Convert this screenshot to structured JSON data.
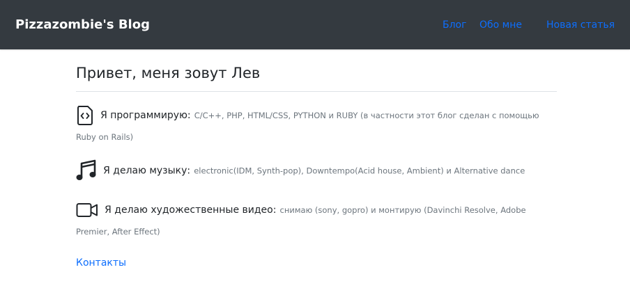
{
  "navbar": {
    "brand": "Pizzazombie's Blog",
    "links": [
      {
        "label": "Блог"
      },
      {
        "label": "Обо мне"
      },
      {
        "label": "Новая статья"
      }
    ],
    "background": "#343a40",
    "link_color": "#0d6efd"
  },
  "main": {
    "title": "Привет, меня зовут Лев",
    "items": [
      {
        "icon": "file-code-icon",
        "lead": "Я программирую:",
        "detail": "C/C++, PHP, HTML/CSS, PYTHON и RUBY (в частности этот блог сделан с помощью Ruby on Rails)"
      },
      {
        "icon": "music-note-icon",
        "lead": "Я делаю музыку:",
        "detail": "electronic(IDM, Synth-pop), Downtempo(Acid house, Ambient) и Alternative dance"
      },
      {
        "icon": "camera-video-icon",
        "lead": "Я делаю художественные видео:",
        "detail": "снимаю (sony, gopro) и монтирую (Davinchi Resolve, Adobe Premier, After Effect)"
      }
    ],
    "contacts_label": "Контакты"
  }
}
